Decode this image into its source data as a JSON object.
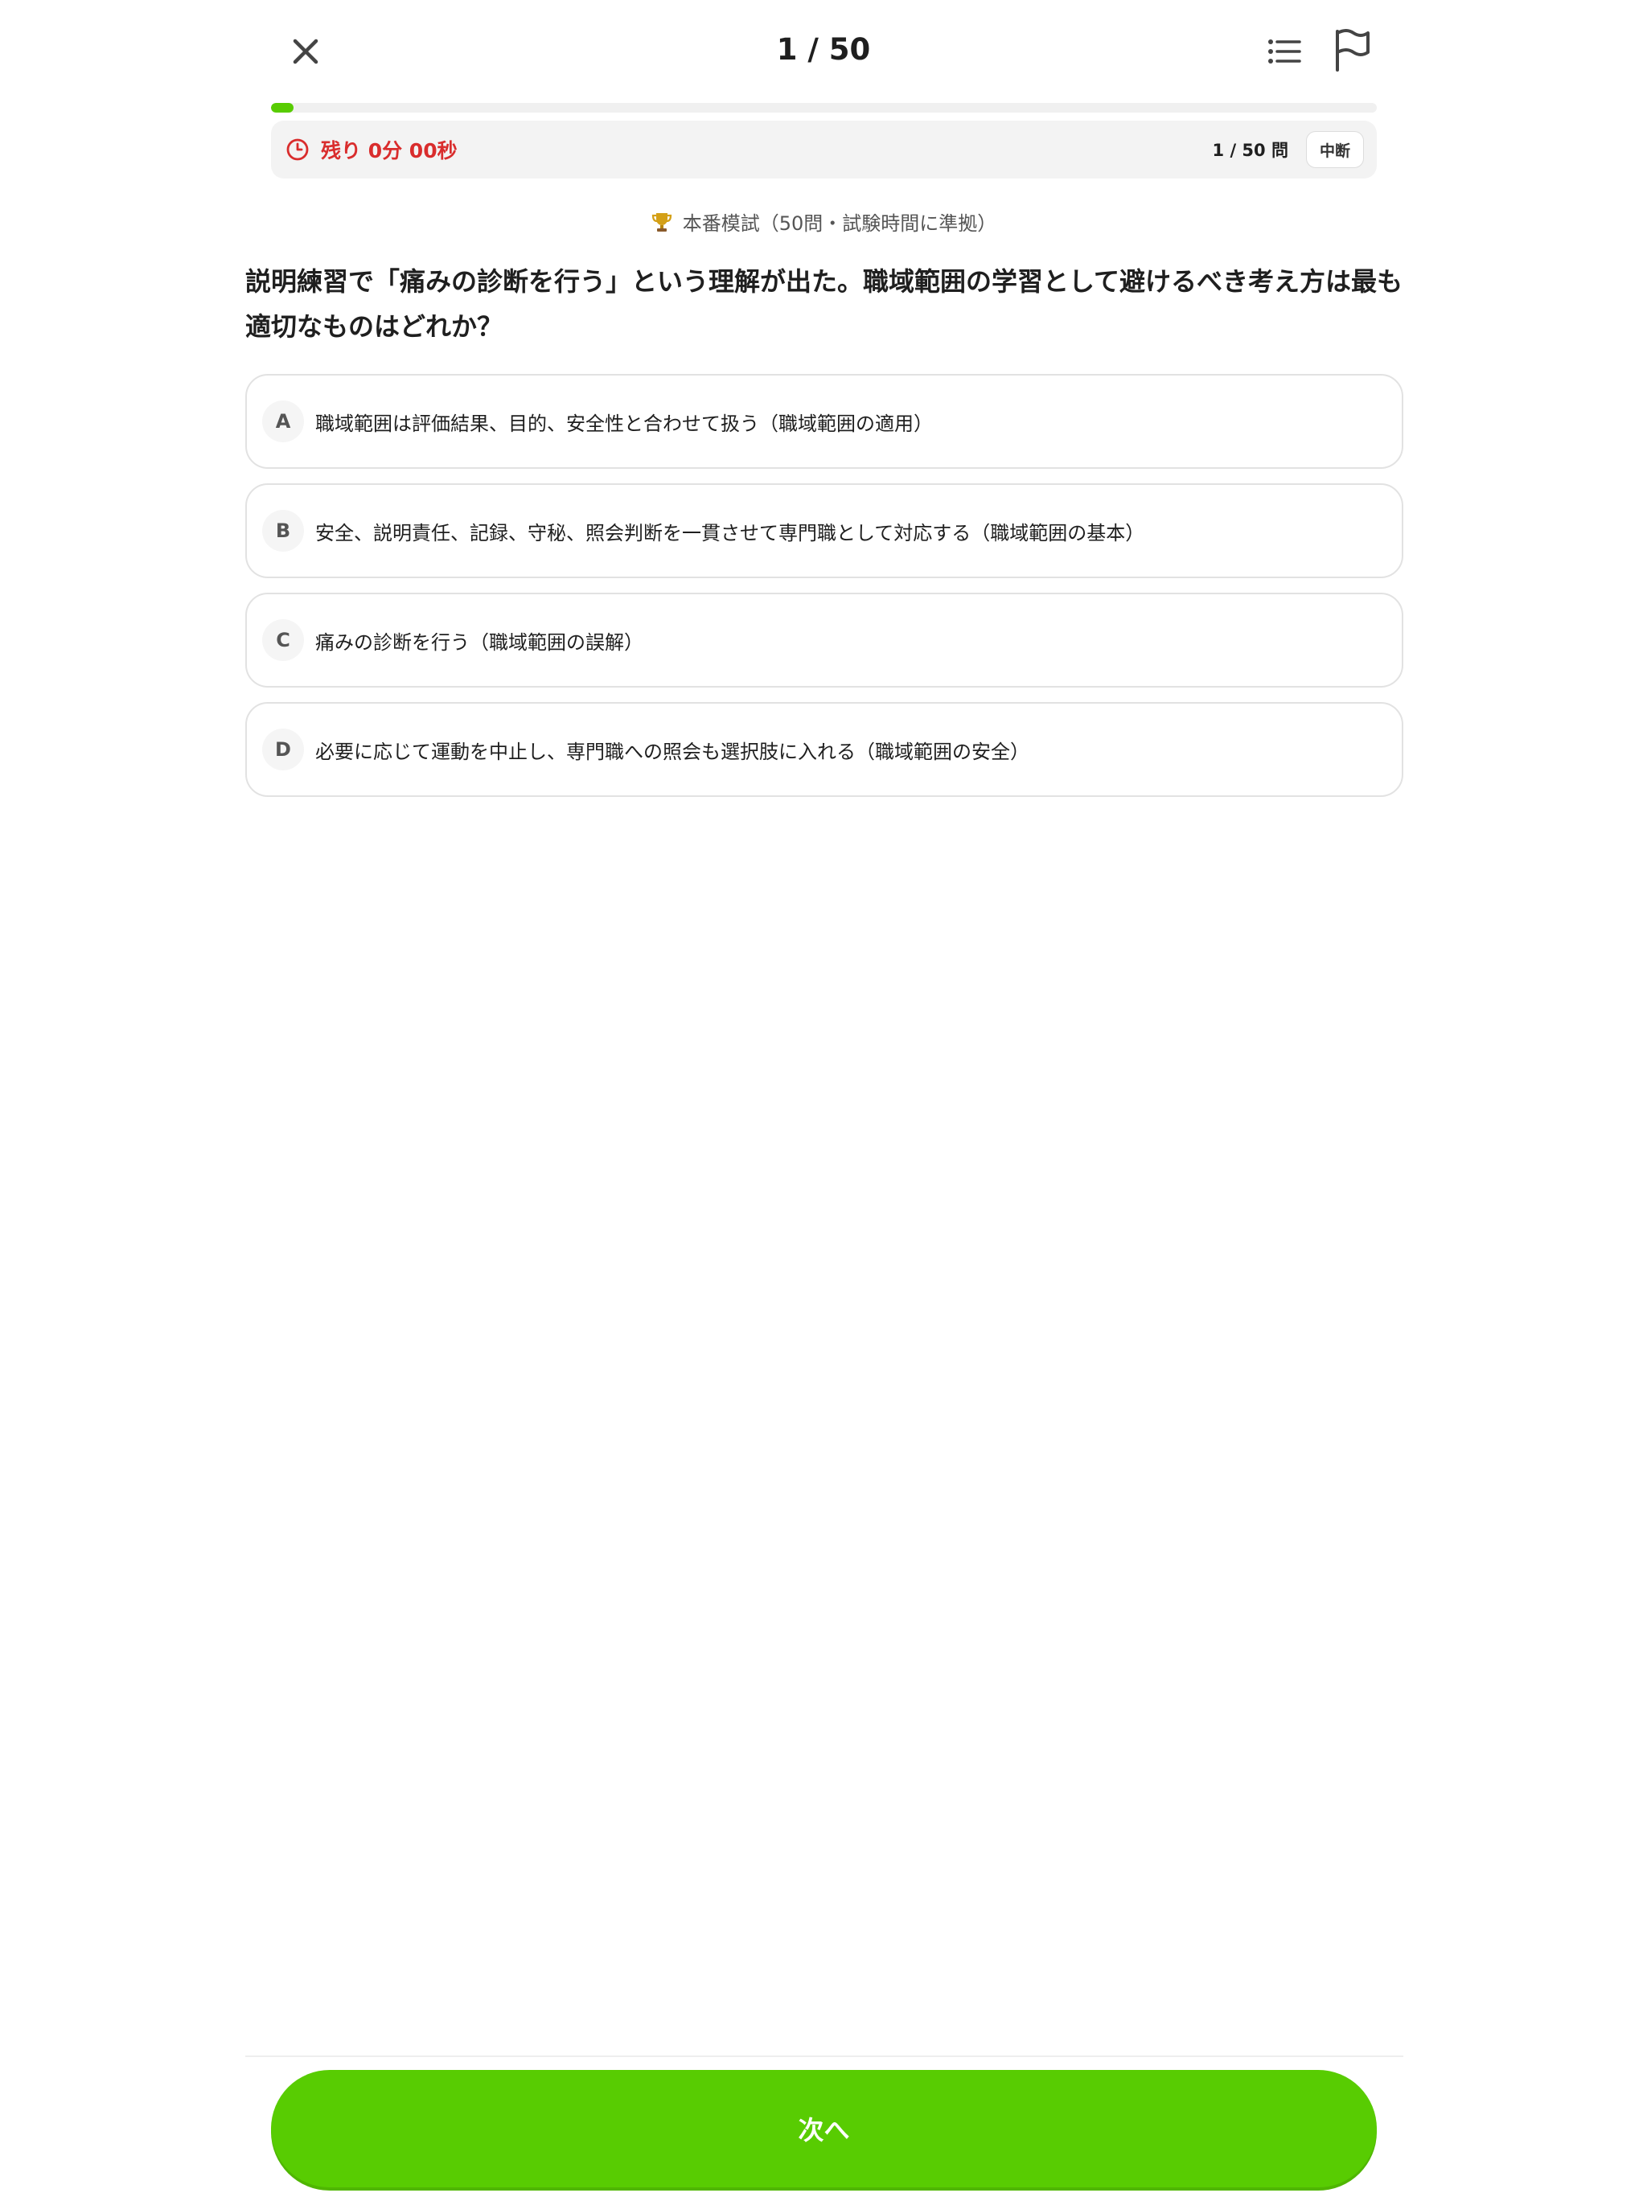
{
  "header": {
    "counter": "1 / 50",
    "close_icon": "close-icon",
    "list_icon": "list-icon",
    "flag_icon": "flag-icon"
  },
  "progress": {
    "fraction": 0.02,
    "color": "#58cc02"
  },
  "timer": {
    "icon": "clock-icon",
    "remaining": "残り 0分 00秒",
    "count": "1 / 50 問",
    "pause_label": "中断",
    "color": "#d92d2d"
  },
  "mode": {
    "icon": "trophy-icon",
    "label": "本番模試（50問・試験時間に準拠）"
  },
  "question": {
    "text": "説明練習で「痛みの診断を行う」という理解が出た。職域範囲の学習として避けるべき考え方は最も適切なものはどれか？"
  },
  "options": [
    {
      "letter": "A",
      "text": "職域範囲は評価結果、目的、安全性と合わせて扱う（職域範囲の適用）"
    },
    {
      "letter": "B",
      "text": "安全、説明責任、記録、守秘、照会判断を一貫させて専門職として対応する（職域範囲の基本）"
    },
    {
      "letter": "C",
      "text": "痛みの診断を行う（職域範囲の誤解）"
    },
    {
      "letter": "D",
      "text": "必要に応じて運動を中止し、専門職への照会も選択肢に入れる（職域範囲の安全）"
    }
  ],
  "footer": {
    "next_label": "次へ",
    "accent": "#58cc02"
  }
}
